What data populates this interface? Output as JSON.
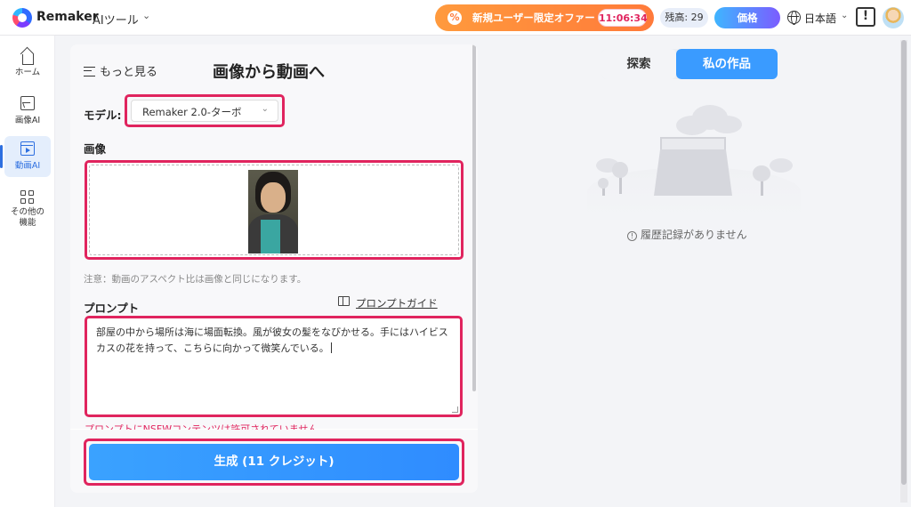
{
  "header": {
    "brand": "Remaker",
    "tools_menu": "AIツール",
    "promo_icon": "%",
    "promo_text": "新規ユーザー限定オファー",
    "promo_timer": "11:06:34",
    "credits": "残高: 29",
    "price_button": "価格",
    "language": "日本語",
    "feedback_icon": "!"
  },
  "sidebar": {
    "items": [
      {
        "label": "ホーム",
        "icon": "home-icon"
      },
      {
        "label": "画像AI",
        "icon": "image-icon"
      },
      {
        "label": "動画AI",
        "icon": "video-icon",
        "active": true
      },
      {
        "label": "その他の機能",
        "icon": "grid-icon"
      }
    ]
  },
  "panel": {
    "more_link": "もっと見る",
    "title": "画像から動画へ",
    "model_label": "モデル:",
    "model_value": "Remaker 2.0-ターボ",
    "image_label": "画像",
    "image_note": "注意：動画のアスペクト比は画像と同じになります。",
    "prompt_label": "プロンプト",
    "prompt_guide": "プロンプトガイド",
    "prompt_text": "部屋の中から場所は海に場面転換。風が彼女の髪をなびかせる。手にはハイビスカスの花を持って、こちらに向かって微笑んでいる。",
    "warning": "プロンプトにNSFWコンテンツは許可されていません",
    "generate_button": "生成 (11 クレジット)"
  },
  "right": {
    "tabs": [
      {
        "label": "探索",
        "active": false
      },
      {
        "label": "私の作品",
        "active": true
      }
    ],
    "empty_message": "履歴記録がありません"
  },
  "colors": {
    "accent": "#3a9bff",
    "highlight": "#e0245e",
    "promo": "#ff7a3a"
  }
}
